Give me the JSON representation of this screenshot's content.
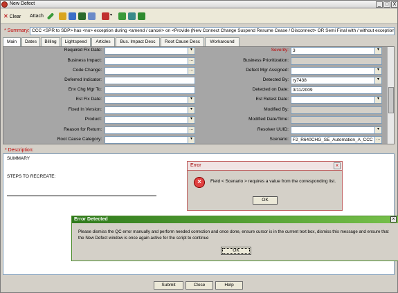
{
  "window": {
    "title": "New Defect"
  },
  "titlebar_buttons": [
    "_",
    "□",
    "X"
  ],
  "toolbar": {
    "clear_label": "Clear",
    "attach_label": "Attach",
    "colors": {
      "green": "#3a9a3a",
      "blue": "#3b6ec8",
      "gold": "#d9a520",
      "red": "#c03030"
    }
  },
  "summary": {
    "label": "* Summary:",
    "value": "CCC <SPR to SDP> has <no> exception during <amend / cancel> on <Provide (New Connect Change Suspend Resume Cease / Disconnect> OR Semi Final with / without exception"
  },
  "tabs": [
    "Main",
    "Dates",
    "Billing",
    "Lightspeed",
    "Articles",
    "Bus. Impact Desc",
    "Root Cause Desc",
    "Workaround"
  ],
  "form": {
    "left": [
      {
        "label": "Required Fix Date:",
        "value": ""
      },
      {
        "label": "Business Impact:",
        "value": ""
      },
      {
        "label": "Code Change:",
        "value": ""
      },
      {
        "label": "Deferred Indicator:",
        "value": ""
      },
      {
        "label": "Env Chg Mgr To:",
        "value": ""
      },
      {
        "label": "Est Fix Date:",
        "value": ""
      },
      {
        "label": "Fixed In Version:",
        "value": ""
      },
      {
        "label": "Product:",
        "value": ""
      },
      {
        "label": "Reason for Return:",
        "value": ""
      },
      {
        "label": "Root Cause Category:",
        "value": ""
      }
    ],
    "right": [
      {
        "label": "Severity:",
        "value": "3"
      },
      {
        "label": "Business Prioritization:",
        "value": ""
      },
      {
        "label": "Defect Mgr Assigned:",
        "value": ""
      },
      {
        "label": "Detected By:",
        "value": "ry7438"
      },
      {
        "label": "Detected on Date:",
        "value": "3/11/2009"
      },
      {
        "label": "Est Retest Date:",
        "value": ""
      },
      {
        "label": "Modified By:",
        "value": ""
      },
      {
        "label": "Modified Date/Time:",
        "value": ""
      },
      {
        "label": "Resolver UUID:",
        "value": ""
      },
      {
        "label": "Scenario:",
        "value": "F2_R640CHG_SE_Automation_A_CCC"
      }
    ]
  },
  "description": {
    "label": "* Description:",
    "lines": [
      "SUMMARY",
      "STEPS TO RECREATE:"
    ]
  },
  "error_dialog": {
    "title": "Error",
    "message": "Field < Scenario > requires a value from the corresponding list.",
    "ok_label": "OK"
  },
  "detected_dialog": {
    "title": "Error Detected",
    "message": "Please dismiss the QC error manually and perform needed correction and once done, ensure cursor is in the current text box, dismiss this message and ensure that the New Defect window is once again active for the script to continue",
    "ok_label": "OK"
  },
  "buttons": {
    "submit": "Submit",
    "close": "Close",
    "help": "Help"
  }
}
